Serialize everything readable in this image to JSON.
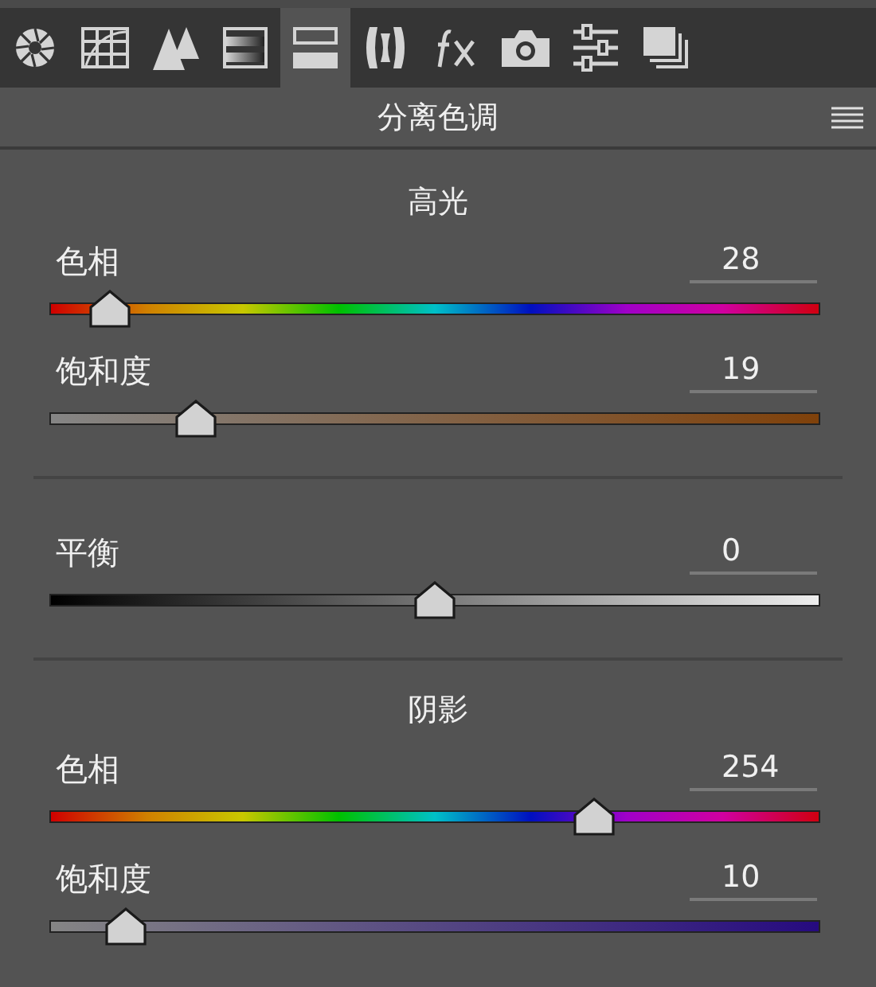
{
  "toolbar": {
    "tabs": [
      {
        "selected": false
      },
      {
        "selected": false
      },
      {
        "selected": false
      },
      {
        "selected": false
      },
      {
        "selected": true
      },
      {
        "selected": false
      },
      {
        "selected": false
      },
      {
        "selected": false
      },
      {
        "selected": false
      },
      {
        "selected": false
      }
    ]
  },
  "panel": {
    "title": "分离色调",
    "sections": [
      {
        "title": "高光",
        "sliders": [
          {
            "kind": "hue",
            "label": "色相",
            "value": "28",
            "level": 0.078
          },
          {
            "kind": "saturation",
            "label": "饱和度",
            "value": "19",
            "level": 0.19
          }
        ]
      },
      {
        "sliders": [
          {
            "kind": "balance",
            "label": "平衡",
            "value": "0",
            "level": 0.5
          }
        ]
      },
      {
        "title": "阴影",
        "sliders": [
          {
            "kind": "hue",
            "label": "色相",
            "value": "254",
            "level": 0.706
          },
          {
            "kind": "saturation",
            "label": "饱和度",
            "value": "10",
            "level": 0.1
          }
        ]
      }
    ]
  }
}
